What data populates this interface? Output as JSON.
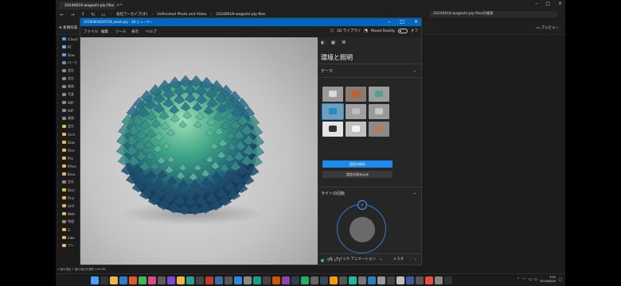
{
  "explorer": {
    "tab_label": "20240618-wagashi-ply-files",
    "breadcrumbs": [
      "会社アーカイブ(オ)",
      "Unfinished Photo and Video",
      "20240618-wagashi-ply-files"
    ],
    "search_placeholder": "20240618-wagashi-ply-filesの検索",
    "new_label": "新規作成",
    "preview_label": "プレビュー",
    "status": "4 個の項目   1 個の項目を選択  428 MB",
    "sidebar": [
      {
        "label": "iCloud",
        "color": "#4a9eff"
      },
      {
        "label": "PC",
        "color": "#5bb3f0"
      },
      {
        "label": "Dow",
        "color": "#4a9eff"
      },
      {
        "label": "ローカ",
        "color": "#8a8a8a"
      },
      {
        "label": "会社",
        "color": "#8a8a8a"
      },
      {
        "label": "会社",
        "color": "#8a8a8a"
      },
      {
        "label": "業務",
        "color": "#8a8a8a"
      },
      {
        "label": "写真",
        "color": "#8a8a8a"
      },
      {
        "label": "WIP",
        "color": "#8a8a8a"
      },
      {
        "label": "WIP",
        "color": "#8a8a8a"
      },
      {
        "label": "業務",
        "color": "#8a8a8a"
      },
      {
        "label": "会社",
        "color": "#e8b84a"
      },
      {
        "label": "Arch",
        "color": "#e8b84a"
      },
      {
        "label": "Dow",
        "color": "#e8b84a"
      },
      {
        "label": "Files",
        "color": "#e8b84a"
      },
      {
        "label": "Pho",
        "color": "#e8b84a"
      },
      {
        "label": "iPhon",
        "color": "#e8b84a"
      },
      {
        "label": "Brea",
        "color": "#e8b84a"
      },
      {
        "label": "会社",
        "color": "#8a8a8a"
      },
      {
        "label": "Desi",
        "color": "#e8b84a"
      },
      {
        "label": "Fina",
        "color": "#e8b84a"
      },
      {
        "label": "Unfi",
        "color": "#e8b84a"
      },
      {
        "label": "Web",
        "color": "#e8b84a"
      },
      {
        "label": "地図",
        "color": "#8a8a8a"
      },
      {
        "label": "Li",
        "color": "#e8b84a"
      },
      {
        "label": "Inbo",
        "color": "#e8b84a"
      },
      {
        "label": "プレ",
        "color": "#e8b84a"
      }
    ]
  },
  "viewer": {
    "title": "24160804020739_mesh.ply - 3D ビューアー",
    "menu": [
      "ファイル",
      "編集",
      "ツール",
      "表示",
      "ヘルプ"
    ],
    "library_label": "3D ライブラリ",
    "mixed_reality_label": "Mixed Reality",
    "toggle_state": "オフ",
    "panel": {
      "title": "環境と照明",
      "theme_label": "テーマ",
      "save_theme": "設定の保存",
      "load_theme": "設定の読み込み",
      "light_rotation_label": "ライトの回転",
      "light1_label": "ライト 1"
    },
    "bottom": {
      "quick_anim": "クイック アニメーション",
      "speed": "× 1.0"
    }
  },
  "taskbar": {
    "time": "6:02",
    "date": "2024/06/20"
  }
}
